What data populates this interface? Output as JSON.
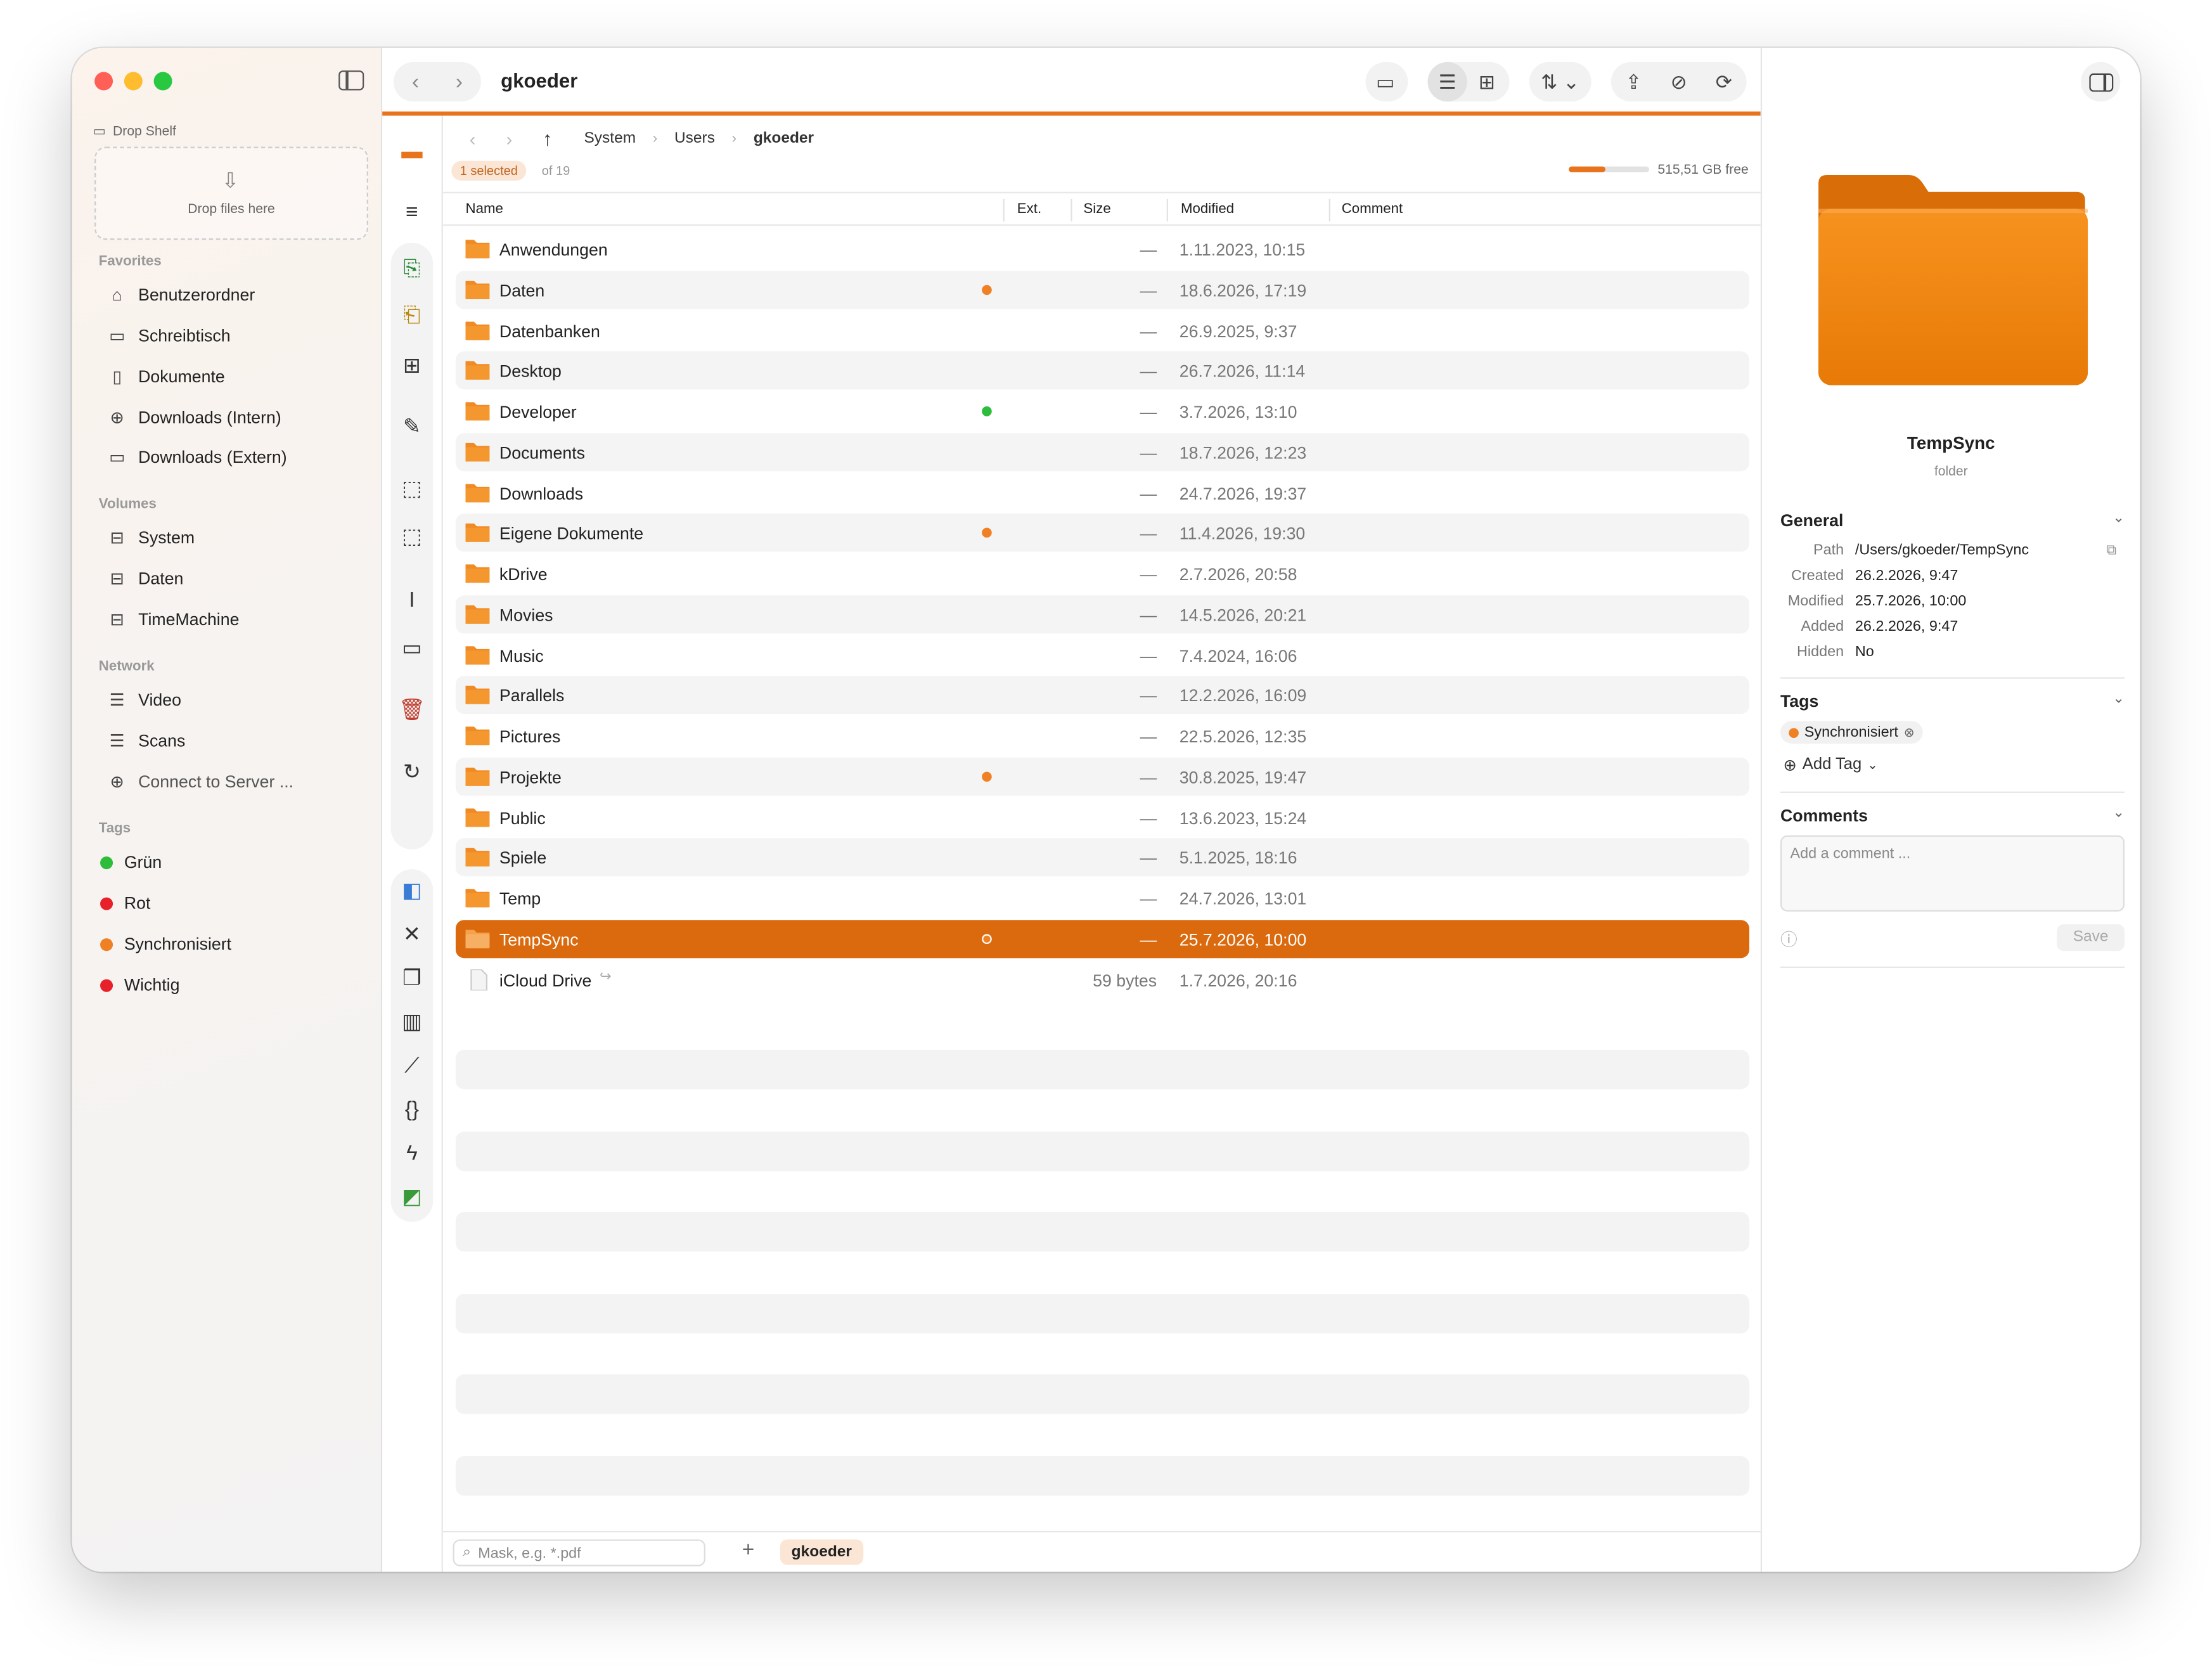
{
  "window": {
    "title": "gkoeder"
  },
  "sidebar": {
    "drop_shelf_label": "Drop Shelf",
    "drop_hint": "Drop files here",
    "favorites_title": "Favorites",
    "favorites": [
      {
        "label": "Benutzerordner",
        "icon": "home-icon"
      },
      {
        "label": "Schreibtisch",
        "icon": "desktop-icon"
      },
      {
        "label": "Dokumente",
        "icon": "document-icon"
      },
      {
        "label": "Downloads (Intern)",
        "icon": "download-icon"
      },
      {
        "label": "Downloads (Extern)",
        "icon": "folder-icon"
      }
    ],
    "volumes_title": "Volumes",
    "volumes": [
      {
        "label": "System",
        "icon": "drive-icon"
      },
      {
        "label": "Daten",
        "icon": "drive-icon"
      },
      {
        "label": "TimeMachine",
        "icon": "drive-icon"
      }
    ],
    "network_title": "Network",
    "network": [
      {
        "label": "Video",
        "icon": "server-icon"
      },
      {
        "label": "Scans",
        "icon": "server-icon"
      },
      {
        "label": "Connect to Server ...",
        "icon": "plus-circle-icon"
      }
    ],
    "tags_title": "Tags",
    "tags": [
      {
        "label": "Grün",
        "color": "#2ebd3b"
      },
      {
        "label": "Rot",
        "color": "#e8202a"
      },
      {
        "label": "Synchronisiert",
        "color": "#f08024"
      },
      {
        "label": "Wichtig",
        "color": "#e8202a"
      }
    ]
  },
  "breadcrumb": [
    "System",
    "Users",
    "gkoeder"
  ],
  "selection": {
    "badge": "1 selected",
    "of": "of 19"
  },
  "disk": {
    "free": "515,51 GB free",
    "used_fraction": 0.45
  },
  "columns": [
    "Name",
    "Ext.",
    "Size",
    "Modified",
    "Comment"
  ],
  "files": [
    {
      "name": "Anwendungen",
      "size": "—",
      "modified": "1.11.2023, 10:15",
      "tag": ""
    },
    {
      "name": "Daten",
      "size": "—",
      "modified": "18.6.2026, 17:19",
      "tag": "#f08024"
    },
    {
      "name": "Datenbanken",
      "size": "—",
      "modified": "26.9.2025, 9:37",
      "tag": ""
    },
    {
      "name": "Desktop",
      "size": "—",
      "modified": "26.7.2026, 11:14",
      "tag": ""
    },
    {
      "name": "Developer",
      "size": "—",
      "modified": "3.7.2026, 13:10",
      "tag": "#2ebd3b"
    },
    {
      "name": "Documents",
      "size": "—",
      "modified": "18.7.2026, 12:23",
      "tag": ""
    },
    {
      "name": "Downloads",
      "size": "—",
      "modified": "24.7.2026, 19:37",
      "tag": ""
    },
    {
      "name": "Eigene Dokumente",
      "size": "—",
      "modified": "11.4.2026, 19:30",
      "tag": "#f08024"
    },
    {
      "name": "kDrive",
      "size": "—",
      "modified": "2.7.2026, 20:58",
      "tag": ""
    },
    {
      "name": "Movies",
      "size": "—",
      "modified": "14.5.2026, 20:21",
      "tag": ""
    },
    {
      "name": "Music",
      "size": "—",
      "modified": "7.4.2024, 16:06",
      "tag": ""
    },
    {
      "name": "Parallels",
      "size": "—",
      "modified": "12.2.2026, 16:09",
      "tag": ""
    },
    {
      "name": "Pictures",
      "size": "—",
      "modified": "22.5.2026, 12:35",
      "tag": ""
    },
    {
      "name": "Projekte",
      "size": "—",
      "modified": "30.8.2025, 19:47",
      "tag": "#f08024"
    },
    {
      "name": "Public",
      "size": "—",
      "modified": "13.6.2023, 15:24",
      "tag": ""
    },
    {
      "name": "Spiele",
      "size": "—",
      "modified": "5.1.2025, 18:16",
      "tag": ""
    },
    {
      "name": "Temp",
      "size": "—",
      "modified": "24.7.2026, 13:01",
      "tag": ""
    },
    {
      "name": "TempSync",
      "size": "—",
      "modified": "25.7.2026, 10:00",
      "tag": "#f08024",
      "selected": true
    },
    {
      "name": "iCloud Drive",
      "size": "59 bytes",
      "modified": "1.7.2026, 20:16",
      "tag": "",
      "alias": true
    }
  ],
  "bottom": {
    "mask_placeholder": "Mask, e.g. *.pdf",
    "location_tab": "gkoeder"
  },
  "inspector": {
    "name": "TempSync",
    "kind": "folder",
    "general_title": "General",
    "general": [
      {
        "key": "Path",
        "value": "/Users/gkoeder/TempSync"
      },
      {
        "key": "Created",
        "value": "26.2.2026, 9:47"
      },
      {
        "key": "Modified",
        "value": "25.7.2026, 10:00"
      },
      {
        "key": "Added",
        "value": "26.2.2026, 9:47"
      },
      {
        "key": "Hidden",
        "value": "No"
      }
    ],
    "tags_title": "Tags",
    "tag_chip": "Synchronisiert",
    "add_tag": "Add Tag",
    "comments_title": "Comments",
    "comment_placeholder": "Add a comment ...",
    "save_label": "Save"
  }
}
